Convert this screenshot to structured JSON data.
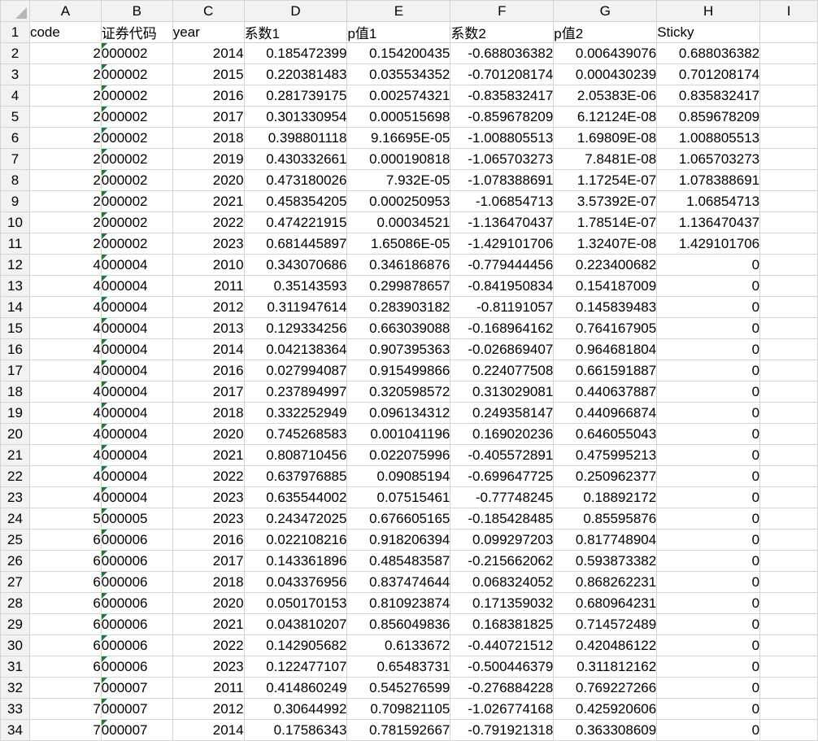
{
  "columns": [
    "A",
    "B",
    "C",
    "D",
    "E",
    "F",
    "G",
    "H",
    "I"
  ],
  "header": [
    "code",
    "证券代码",
    "year",
    "系数1",
    "p值1",
    "系数2",
    "p值2",
    "Sticky",
    ""
  ],
  "rows": [
    [
      "2",
      "000002",
      "2014",
      "0.185472399",
      "0.154200435",
      "-0.688036382",
      "0.006439076",
      "0.688036382"
    ],
    [
      "2",
      "000002",
      "2015",
      "0.220381483",
      "0.035534352",
      "-0.701208174",
      "0.000430239",
      "0.701208174"
    ],
    [
      "2",
      "000002",
      "2016",
      "0.281739175",
      "0.002574321",
      "-0.835832417",
      "2.05383E-06",
      "0.835832417"
    ],
    [
      "2",
      "000002",
      "2017",
      "0.301330954",
      "0.000515698",
      "-0.859678209",
      "6.12124E-08",
      "0.859678209"
    ],
    [
      "2",
      "000002",
      "2018",
      "0.398801118",
      "9.16695E-05",
      "-1.008805513",
      "1.69809E-08",
      "1.008805513"
    ],
    [
      "2",
      "000002",
      "2019",
      "0.430332661",
      "0.000190818",
      "-1.065703273",
      "7.8481E-08",
      "1.065703273"
    ],
    [
      "2",
      "000002",
      "2020",
      "0.473180026",
      "7.932E-05",
      "-1.078388691",
      "1.17254E-07",
      "1.078388691"
    ],
    [
      "2",
      "000002",
      "2021",
      "0.458354205",
      "0.000250953",
      "-1.06854713",
      "3.57392E-07",
      "1.06854713"
    ],
    [
      "2",
      "000002",
      "2022",
      "0.474221915",
      "0.00034521",
      "-1.136470437",
      "1.78514E-07",
      "1.136470437"
    ],
    [
      "2",
      "000002",
      "2023",
      "0.681445897",
      "1.65086E-05",
      "-1.429101706",
      "1.32407E-08",
      "1.429101706"
    ],
    [
      "4",
      "000004",
      "2010",
      "0.343070686",
      "0.346186876",
      "-0.779444456",
      "0.223400682",
      "0"
    ],
    [
      "4",
      "000004",
      "2011",
      "0.35143593",
      "0.299878657",
      "-0.841950834",
      "0.154187009",
      "0"
    ],
    [
      "4",
      "000004",
      "2012",
      "0.311947614",
      "0.283903182",
      "-0.81191057",
      "0.145839483",
      "0"
    ],
    [
      "4",
      "000004",
      "2013",
      "0.129334256",
      "0.663039088",
      "-0.168964162",
      "0.764167905",
      "0"
    ],
    [
      "4",
      "000004",
      "2014",
      "0.042138364",
      "0.907395363",
      "-0.026869407",
      "0.964681804",
      "0"
    ],
    [
      "4",
      "000004",
      "2016",
      "0.027994087",
      "0.915499866",
      "0.224077508",
      "0.661591887",
      "0"
    ],
    [
      "4",
      "000004",
      "2017",
      "0.237894997",
      "0.320598572",
      "0.313029081",
      "0.440637887",
      "0"
    ],
    [
      "4",
      "000004",
      "2018",
      "0.332252949",
      "0.096134312",
      "0.249358147",
      "0.440966874",
      "0"
    ],
    [
      "4",
      "000004",
      "2020",
      "0.745268583",
      "0.001041196",
      "0.169020236",
      "0.646055043",
      "0"
    ],
    [
      "4",
      "000004",
      "2021",
      "0.808710456",
      "0.022075996",
      "-0.405572891",
      "0.475995213",
      "0"
    ],
    [
      "4",
      "000004",
      "2022",
      "0.637976885",
      "0.09085194",
      "-0.699647725",
      "0.250962377",
      "0"
    ],
    [
      "4",
      "000004",
      "2023",
      "0.635544002",
      "0.07515461",
      "-0.77748245",
      "0.18892172",
      "0"
    ],
    [
      "5",
      "000005",
      "2023",
      "0.243472025",
      "0.676605165",
      "-0.185428485",
      "0.85595876",
      "0"
    ],
    [
      "6",
      "000006",
      "2016",
      "0.022108216",
      "0.918206394",
      "0.099297203",
      "0.817748904",
      "0"
    ],
    [
      "6",
      "000006",
      "2017",
      "0.143361896",
      "0.485483587",
      "-0.215662062",
      "0.593873382",
      "0"
    ],
    [
      "6",
      "000006",
      "2018",
      "0.043376956",
      "0.837474644",
      "0.068324052",
      "0.868262231",
      "0"
    ],
    [
      "6",
      "000006",
      "2020",
      "0.050170153",
      "0.810923874",
      "0.171359032",
      "0.680964231",
      "0"
    ],
    [
      "6",
      "000006",
      "2021",
      "0.043810207",
      "0.856049836",
      "0.168381825",
      "0.714572489",
      "0"
    ],
    [
      "6",
      "000006",
      "2022",
      "0.142905682",
      "0.6133672",
      "-0.440721512",
      "0.420486122",
      "0"
    ],
    [
      "6",
      "000006",
      "2023",
      "0.122477107",
      "0.65483731",
      "-0.500446379",
      "0.311812162",
      "0"
    ],
    [
      "7",
      "000007",
      "2011",
      "0.414860249",
      "0.545276599",
      "-0.276884228",
      "0.769227266",
      "0"
    ],
    [
      "7",
      "000007",
      "2012",
      "0.30644992",
      "0.709821105",
      "-1.026774168",
      "0.425920606",
      "0"
    ],
    [
      "7",
      "000007",
      "2014",
      "0.17586343",
      "0.781592667",
      "-0.791921318",
      "0.363308609",
      "0"
    ]
  ],
  "colors": {
    "header_bg": "#f2f2f2",
    "gridline": "#d4d4d4",
    "text_marker": "#1e7b34"
  }
}
